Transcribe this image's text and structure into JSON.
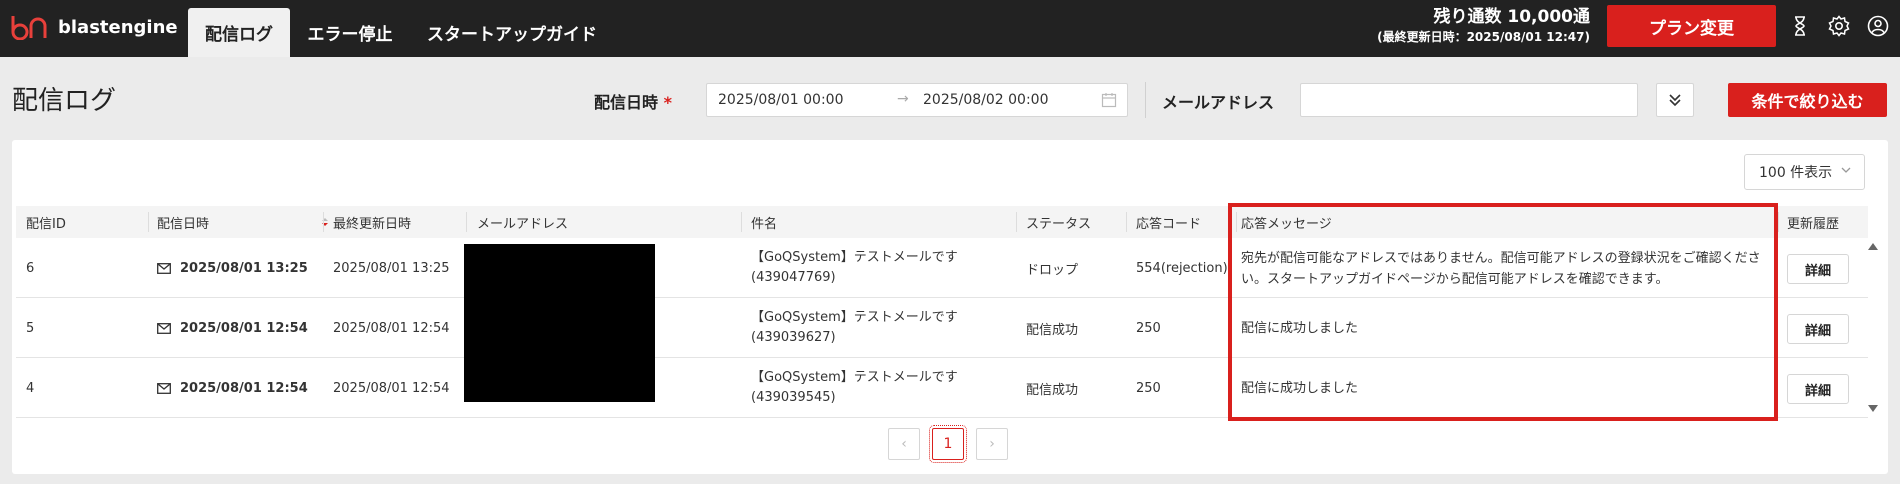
{
  "app": {
    "name": "blastengine"
  },
  "nav": {
    "tabs": [
      {
        "label": "配信ログ"
      },
      {
        "label": "エラー停止"
      },
      {
        "label": "スタートアップガイド"
      }
    ]
  },
  "header": {
    "remaining_label": "残り通数",
    "remaining_value": "10,000通",
    "last_updated": "(最終更新日時：2025/08/01 12:47)",
    "plan_button": "プラン変更",
    "icons": [
      "hourglass-icon",
      "settings-icon",
      "user-icon"
    ]
  },
  "page": {
    "title": "配信ログ"
  },
  "filters": {
    "date_label": "配信日時",
    "required_mark": "*",
    "date_from": "2025/08/01 00:00",
    "date_to": "2025/08/02 00:00",
    "arrow": "→",
    "email_label": "メールアドレス",
    "email_value": "",
    "submit_label": "条件で絞り込む"
  },
  "per_page": {
    "label": "100 件表示",
    "chevron": "〉"
  },
  "table": {
    "headers": [
      "配信ID",
      "配信日時",
      "最終更新日時",
      "メールアドレス",
      "件名",
      "ステータス",
      "応答コード",
      "応答メッセージ",
      "更新履歴"
    ],
    "rows": [
      {
        "id": "6",
        "sent": "2025/08/01 13:25",
        "updated": "2025/08/01 13:25",
        "subject_line1": "【GoQSystem】テストメールです",
        "subject_line2": "(439047769)",
        "status": "ドロップ",
        "code": "554(rejection)",
        "message": "宛先が配信可能なアドレスではありません。配信可能アドレスの登録状況をご確認ください。スタートアップガイドページから配信可能アドレスを確認できます。",
        "detail": "詳細"
      },
      {
        "id": "5",
        "sent": "2025/08/01 12:54",
        "updated": "2025/08/01 12:54",
        "subject_line1": "【GoQSystem】テストメールです",
        "subject_line2": "(439039627)",
        "status": "配信成功",
        "code": "250",
        "message": "配信に成功しました",
        "detail": "詳細"
      },
      {
        "id": "4",
        "sent": "2025/08/01 12:54",
        "updated": "2025/08/01 12:54",
        "subject_line1": "【GoQSystem】テストメールです",
        "subject_line2": "(439039545)",
        "status": "配信成功",
        "code": "250",
        "message": "配信に成功しました",
        "detail": "詳細"
      }
    ]
  },
  "pagination": {
    "prev": "‹",
    "current": "1",
    "next": "›"
  },
  "colors": {
    "accent": "#d9201d",
    "header_bg": "#222222",
    "page_bg": "#ebebeb"
  }
}
